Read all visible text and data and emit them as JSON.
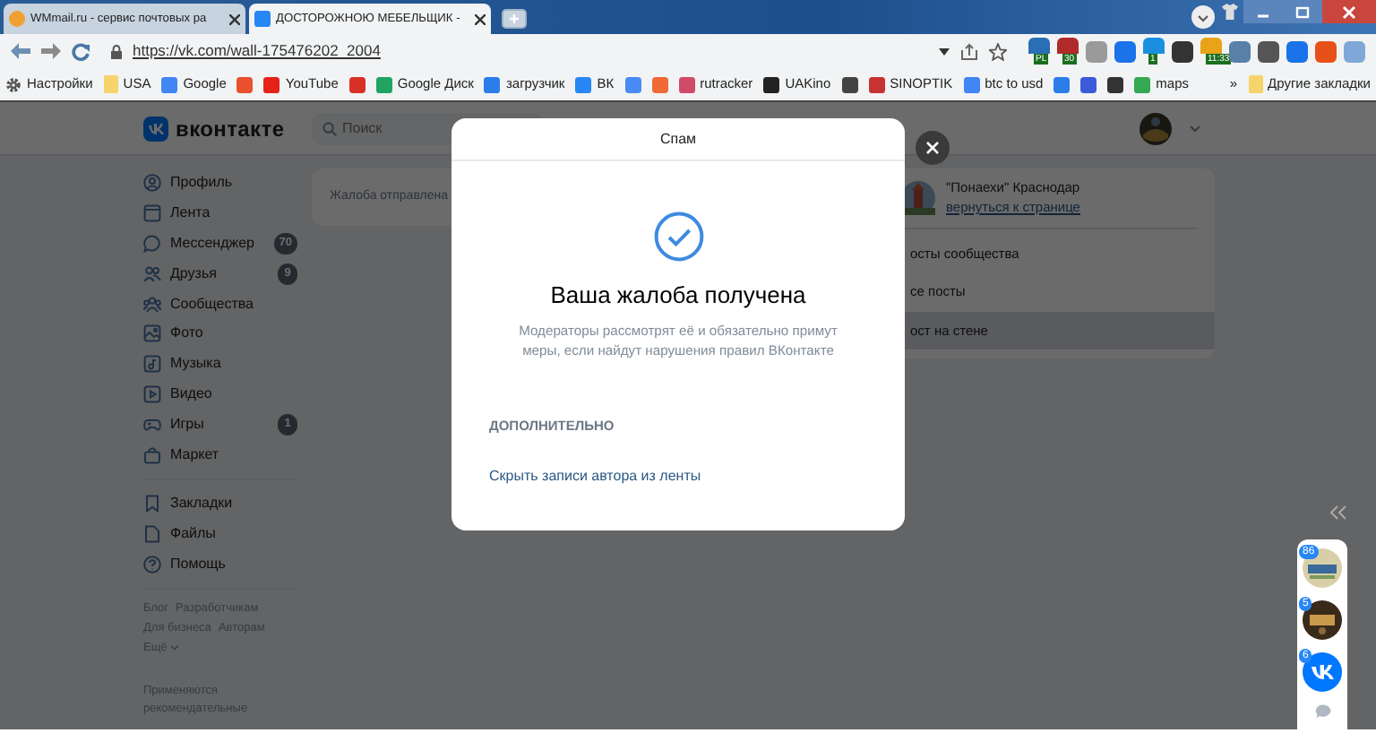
{
  "browser": {
    "tabs": [
      {
        "title": "WMmail.ru - сервис почтовых ра",
        "selected": false,
        "color": "#f0a030"
      },
      {
        "title": "ДОСТОРОЖНОЮ МЕБЕЛЬЩИК -",
        "selected": true,
        "color": "#2787f5"
      }
    ],
    "url": "https://vk.com/wall-175476202_2004",
    "extensions": [
      {
        "color": "#2a6fb5",
        "badge": "PL"
      },
      {
        "color": "#b02a2a",
        "badge": "30"
      },
      {
        "color": "#9a9a9a"
      },
      {
        "color": "#1a73e8"
      },
      {
        "color": "#1a8fe0",
        "badge": "1"
      },
      {
        "color": "#333333"
      },
      {
        "color": "#e8a317",
        "badge": "11:33"
      },
      {
        "color": "#5a7fa8"
      },
      {
        "color": "#555555"
      },
      {
        "color": "#1a73e8"
      },
      {
        "color": "#e8501a"
      },
      {
        "color": "#7fa8d8"
      }
    ],
    "bookmarks": [
      {
        "kind": "gear",
        "label": "Настройки",
        "color": "#555555"
      },
      {
        "kind": "folder",
        "label": "USA",
        "color": "#f6d36b"
      },
      {
        "kind": "site",
        "label": "Google",
        "color": "#4285f4"
      },
      {
        "kind": "site",
        "color": "#e8502e"
      },
      {
        "kind": "site",
        "label": "YouTube",
        "color": "#e62117"
      },
      {
        "kind": "site",
        "color": "#d93025"
      },
      {
        "kind": "site",
        "label": "Google Диск",
        "color": "#1fa463"
      },
      {
        "kind": "site",
        "label": "загрузчик",
        "color": "#2b7de9"
      },
      {
        "kind": "site",
        "label": "ВК",
        "color": "#2787f5"
      },
      {
        "kind": "site",
        "color": "#4a8af4"
      },
      {
        "kind": "site",
        "color": "#f06a35"
      },
      {
        "kind": "site",
        "label": "rutracker",
        "color": "#d04a6a"
      },
      {
        "kind": "site",
        "label": "UAKino",
        "color": "#222222"
      },
      {
        "kind": "site",
        "color": "#444444"
      },
      {
        "kind": "site",
        "label": "SINOPTIK",
        "color": "#c83232"
      },
      {
        "kind": "site",
        "label": "btc to usd",
        "color": "#4285f4"
      },
      {
        "kind": "site",
        "color": "#2b7de9"
      },
      {
        "kind": "site",
        "color": "#3b5bdb"
      },
      {
        "kind": "site",
        "color": "#333333"
      },
      {
        "kind": "site",
        "label": "maps",
        "color": "#34a853"
      }
    ],
    "more_bookmarks": "»",
    "other_bookmarks": "Другие закладки"
  },
  "vk": {
    "logo": "вконтакте",
    "search": {
      "placeholder": "Поиск"
    },
    "menu": [
      {
        "kind": "profile",
        "label": "Профиль"
      },
      {
        "kind": "feed",
        "label": "Лента"
      },
      {
        "kind": "messenger",
        "label": "Мессенджер",
        "count": "70"
      },
      {
        "kind": "friends",
        "label": "Друзья",
        "count": "9"
      },
      {
        "kind": "communities",
        "label": "Сообщества"
      },
      {
        "label": "Фото"
      },
      {
        "kind": "music",
        "label": "Музыка"
      },
      {
        "kind": "video",
        "label": "Видео"
      },
      {
        "kind": "games",
        "label": "Игры",
        "count": "1"
      },
      {
        "kind": "market",
        "label": "Маркет"
      }
    ],
    "menu_secondary": [
      {
        "kind": "bookmarks",
        "label": "Закладки"
      },
      {
        "kind": "files",
        "label": "Файлы"
      },
      {
        "kind": "help",
        "label": "Помощь"
      }
    ],
    "footer_links": [
      "Блог",
      "Разработчикам",
      "Для бизнеса",
      "Авторам",
      "Ещё"
    ],
    "footer_note": "Применяются рекомендательные",
    "notice": "Жалоба отправлена",
    "community": {
      "name": "\"Понаехи\" Краснодар",
      "action": "вернуться к странице",
      "links": [
        {
          "label": "осты сообщества",
          "selected": false
        },
        {
          "label": "се посты",
          "selected": false
        },
        {
          "label": "ост на стене",
          "selected": true
        }
      ]
    },
    "quick_chats": [
      {
        "kind": "picture",
        "badge": "86"
      },
      {
        "kind": "picture",
        "badge": "5"
      },
      {
        "kind": "logo",
        "badge": "6"
      }
    ]
  },
  "modal": {
    "title": "Спам",
    "heading": "Ваша жалоба получена",
    "text": "Модераторы рассмотрят её и обязательно примут меры, если найдут нарушения правил ВКонтакте",
    "section": "ДОПОЛНИТЕЛЬНО",
    "link": "Скрыть записи автора из ленты"
  }
}
